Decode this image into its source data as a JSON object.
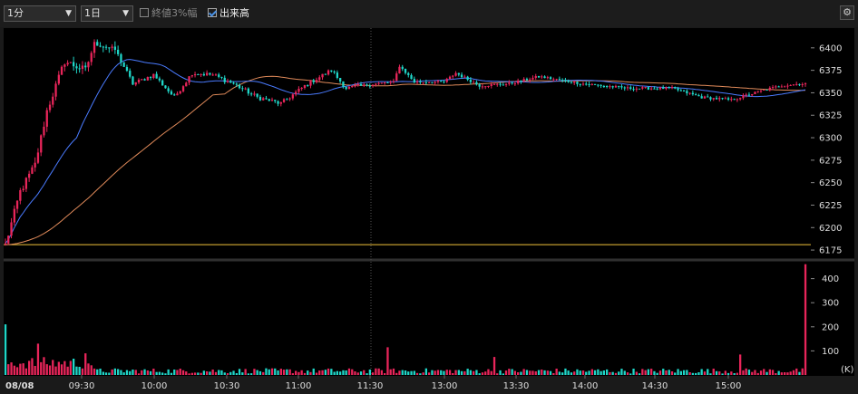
{
  "toolbar": {
    "interval": "1分",
    "period": "1日",
    "option_close3": "終値3%幅",
    "option_volume": "出来高",
    "option_close3_checked": false,
    "option_volume_checked": true,
    "settings_icon": "gear-icon"
  },
  "colors": {
    "up": "#e8255a",
    "down": "#1fd6c8",
    "ma_short": "#4a7bff",
    "ma_long": "#e08a5a",
    "ref_line": "#f0c23a",
    "grid": "#3a3a3a",
    "background": "#000000"
  },
  "chart_data": [
    {
      "type": "candlestick",
      "name": "price",
      "y_ticks": [
        6175,
        6200,
        6225,
        6250,
        6275,
        6300,
        6325,
        6350,
        6375,
        6400
      ],
      "ylim": [
        6166,
        6422
      ],
      "reference_line": 6181,
      "x_ticks": [
        "08/08",
        "09:30",
        "10:00",
        "10:30",
        "11:00",
        "11:30",
        "13:00",
        "13:30",
        "14:00",
        "14:30",
        "15:00"
      ],
      "keyframes": [
        {
          "t": 0,
          "v": 6181
        },
        {
          "t": 5,
          "v": 6240
        },
        {
          "t": 10,
          "v": 6270
        },
        {
          "t": 14,
          "v": 6330
        },
        {
          "t": 20,
          "v": 6385
        },
        {
          "t": 27,
          "v": 6375
        },
        {
          "t": 30,
          "v": 6405
        },
        {
          "t": 37,
          "v": 6398
        },
        {
          "t": 43,
          "v": 6360
        },
        {
          "t": 50,
          "v": 6370
        },
        {
          "t": 57,
          "v": 6345
        },
        {
          "t": 63,
          "v": 6372
        },
        {
          "t": 70,
          "v": 6370
        },
        {
          "t": 77,
          "v": 6360
        },
        {
          "t": 85,
          "v": 6345
        },
        {
          "t": 93,
          "v": 6338
        },
        {
          "t": 102,
          "v": 6360
        },
        {
          "t": 110,
          "v": 6375
        },
        {
          "t": 115,
          "v": 6355
        },
        {
          "t": 125,
          "v": 6360
        },
        {
          "t": 131,
          "v": 6362
        },
        {
          "t": 133,
          "v": 6380
        },
        {
          "t": 138,
          "v": 6362
        },
        {
          "t": 148,
          "v": 6362
        },
        {
          "t": 152,
          "v": 6372
        },
        {
          "t": 160,
          "v": 6358
        },
        {
          "t": 170,
          "v": 6360
        },
        {
          "t": 180,
          "v": 6368
        },
        {
          "t": 195,
          "v": 6360
        },
        {
          "t": 210,
          "v": 6355
        },
        {
          "t": 225,
          "v": 6355
        },
        {
          "t": 235,
          "v": 6345
        },
        {
          "t": 245,
          "v": 6342
        },
        {
          "t": 255,
          "v": 6352
        },
        {
          "t": 262,
          "v": 6358
        },
        {
          "t": 268,
          "v": 6360
        }
      ]
    },
    {
      "type": "bar",
      "name": "volume",
      "unit": "(K)",
      "y_ticks": [
        100,
        200,
        300,
        400
      ],
      "ylim": [
        0,
        470
      ],
      "notable_bars": [
        {
          "t": 0,
          "v": 210
        },
        {
          "t": 11,
          "v": 130
        },
        {
          "t": 27,
          "v": 90
        },
        {
          "t": 129,
          "v": 115
        },
        {
          "t": 165,
          "v": 75
        },
        {
          "t": 248,
          "v": 85
        },
        {
          "t": 270,
          "v": 460
        }
      ]
    }
  ]
}
